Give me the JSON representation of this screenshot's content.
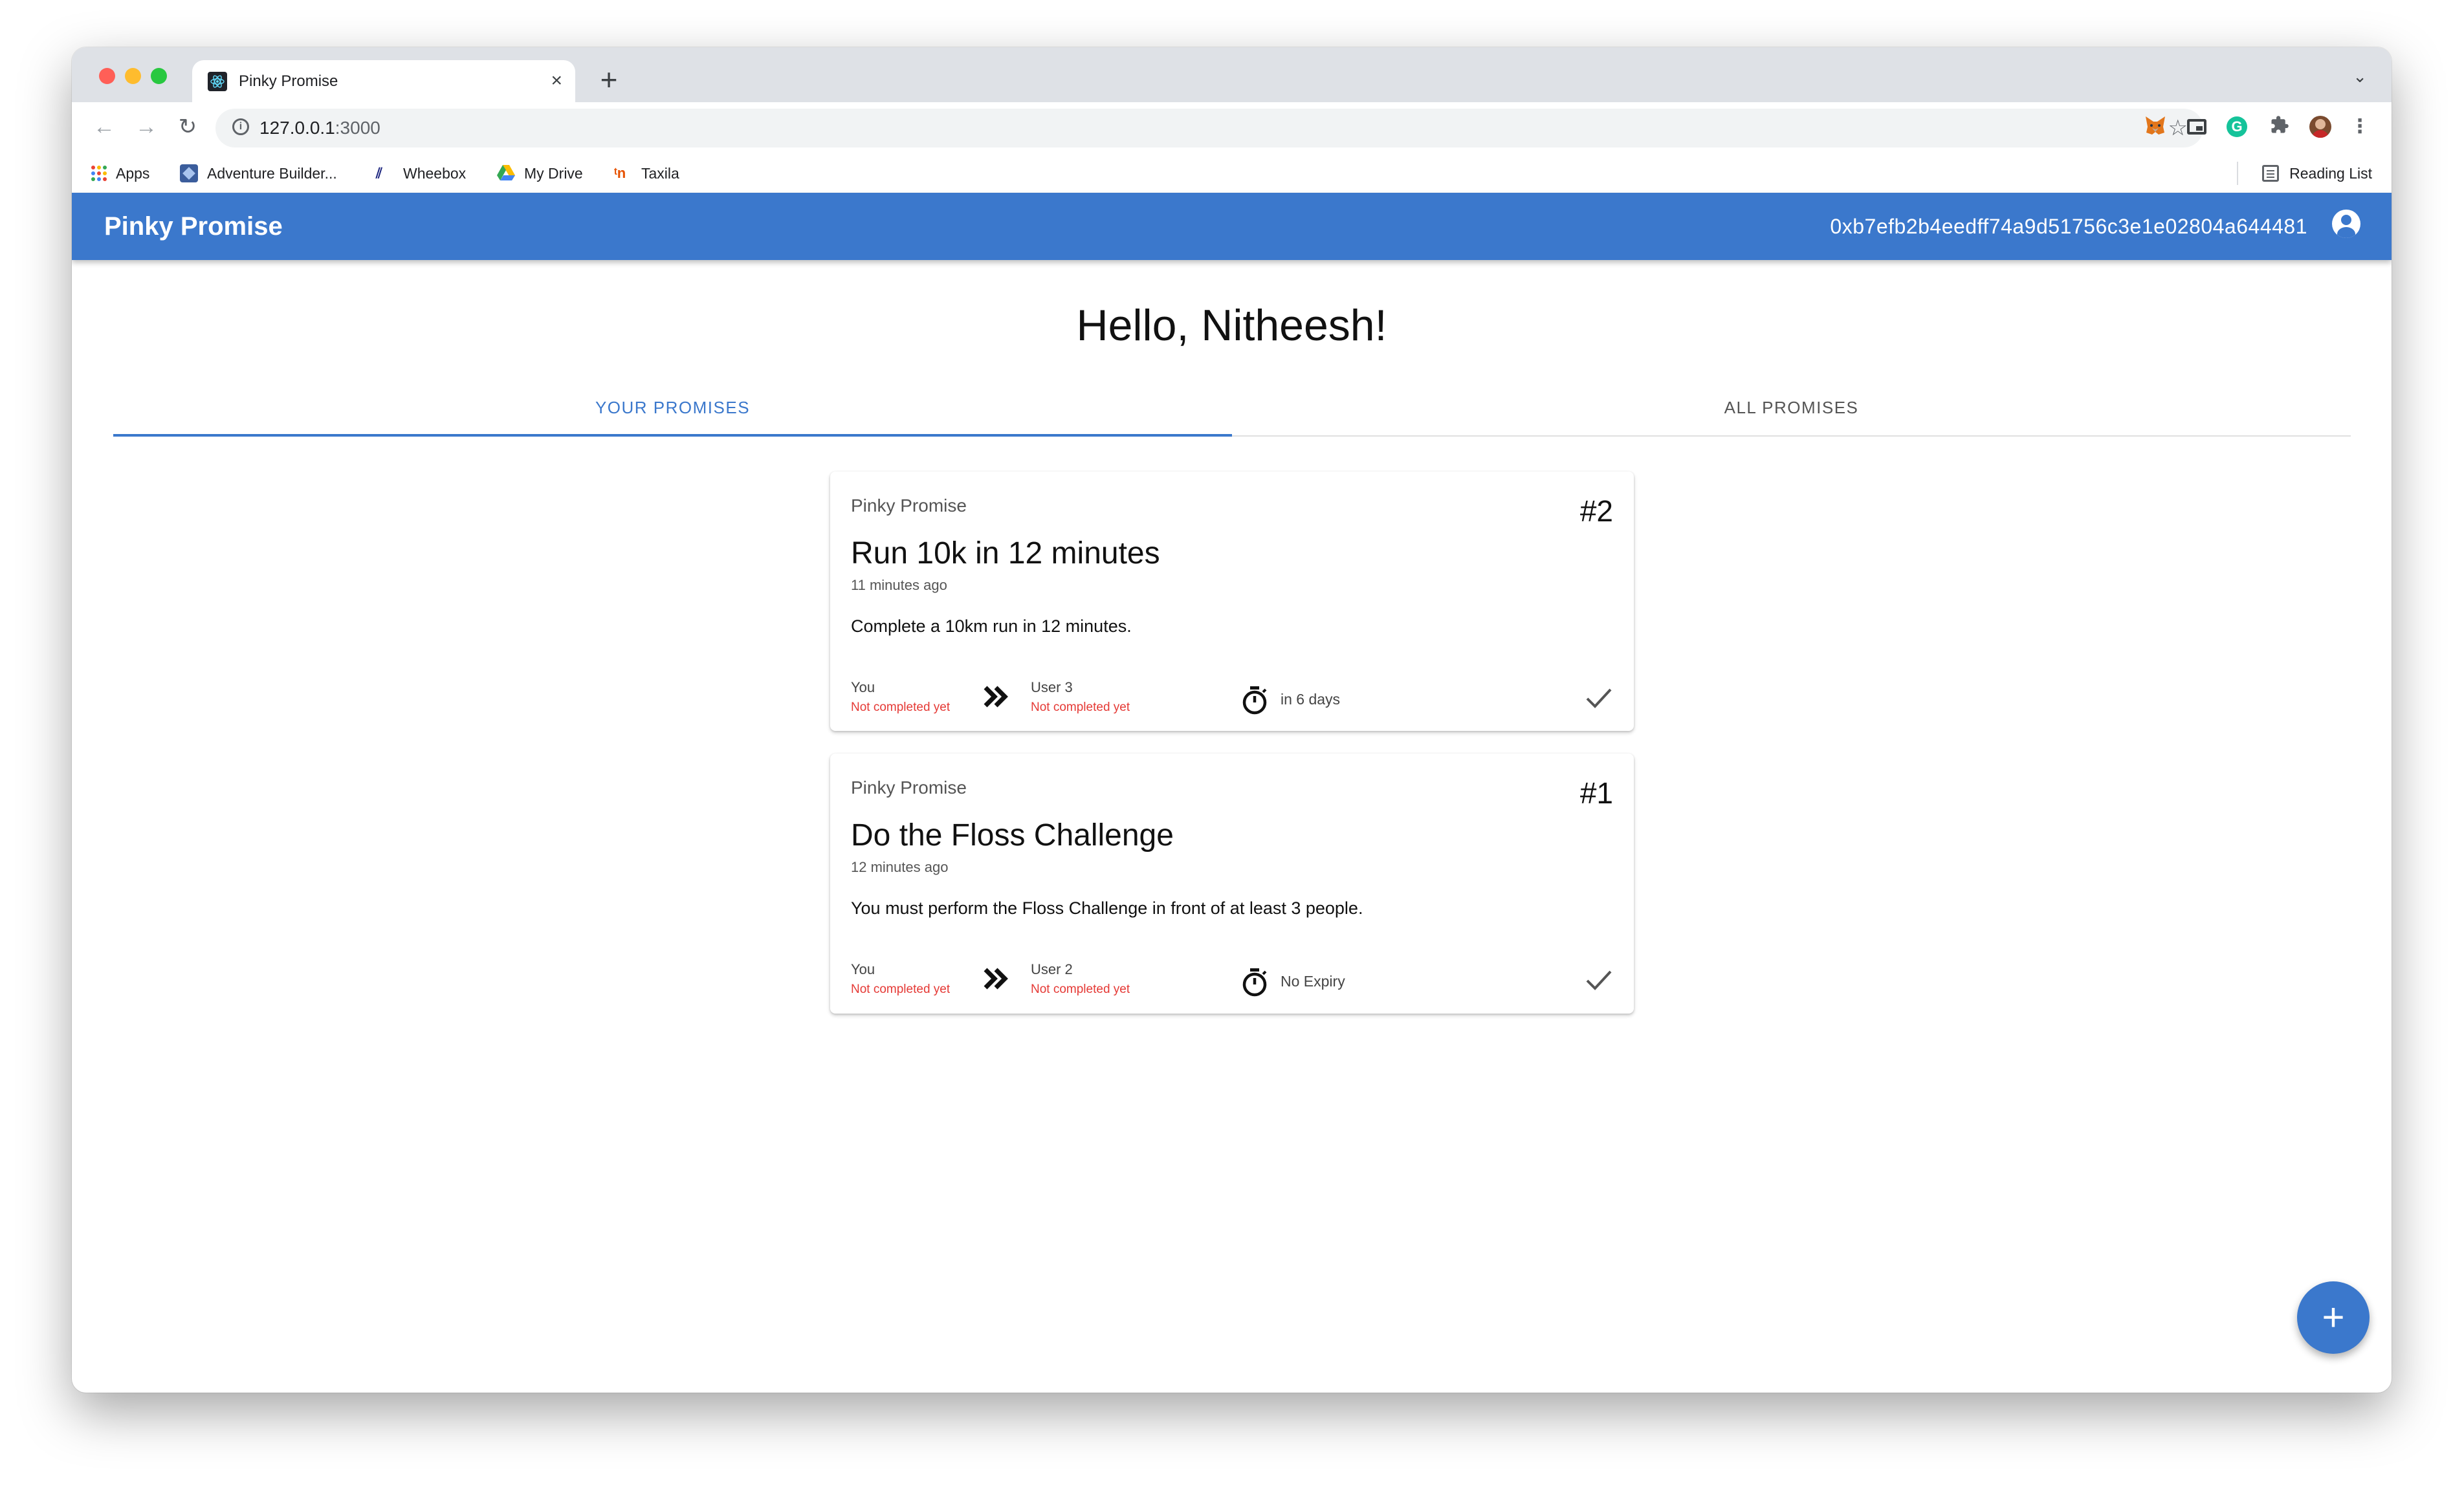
{
  "browser": {
    "tab_title": "Pinky Promise",
    "tab_close": "×",
    "new_tab": "+",
    "tab_dropdown": "⌄",
    "url_host": "127.0.0.1",
    "url_port": ":3000",
    "bookmarks": [
      {
        "label": "Apps",
        "icon": "apps-grid-icon"
      },
      {
        "label": "Adventure Builder...",
        "icon": "adventure-builder-icon"
      },
      {
        "label": "Wheebox",
        "icon": "wheebox-icon"
      },
      {
        "label": "My Drive",
        "icon": "google-drive-icon"
      },
      {
        "label": "Taxila",
        "icon": "taxila-icon"
      }
    ],
    "reading_list": "Reading List",
    "extensions": [
      "metamask-fox-icon",
      "picture-in-picture-icon",
      "grammarly-icon",
      "puzzle-icon",
      "profile-avatar-icon",
      "more-vert-icon"
    ]
  },
  "app": {
    "title": "Pinky Promise",
    "address": "0xb7efb2b4eedff74a9d51756c3e1e02804a644481",
    "greeting": "Hello, Nitheesh!",
    "tabs": [
      {
        "label": "YOUR PROMISES",
        "active": true
      },
      {
        "label": "ALL PROMISES",
        "active": false
      }
    ],
    "fab_label": "+",
    "accent_color": "#3b78cc",
    "status_color": "#e53935"
  },
  "promises": [
    {
      "overline": "Pinky Promise",
      "number": "#2",
      "title": "Run 10k in 12 minutes",
      "time": "11 minutes ago",
      "description": "Complete a 10km run in 12 minutes.",
      "from_name": "You",
      "from_status": "Not completed yet",
      "to_name": "User 3",
      "to_status": "Not completed yet",
      "expiry": "in 6 days"
    },
    {
      "overline": "Pinky Promise",
      "number": "#1",
      "title": "Do the Floss Challenge",
      "time": "12 minutes ago",
      "description": "You must perform the Floss Challenge in front of at least 3 people.",
      "from_name": "You",
      "from_status": "Not completed yet",
      "to_name": "User 2",
      "to_status": "Not completed yet",
      "expiry": "No Expiry"
    }
  ]
}
